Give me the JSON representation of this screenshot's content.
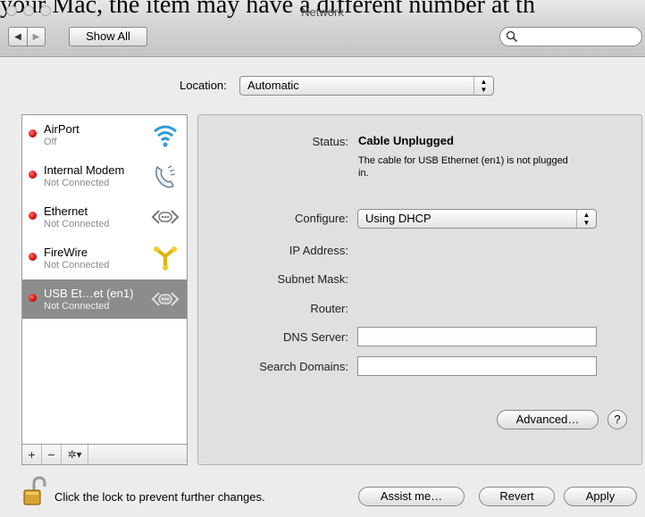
{
  "caption_fragment": "your Mac, the item may have a different number at th",
  "window": {
    "title": "Network"
  },
  "toolbar": {
    "back_glyph": "◀",
    "forward_glyph": "▶",
    "show_all_label": "Show All",
    "search_placeholder": ""
  },
  "location": {
    "label": "Location:",
    "value": "Automatic"
  },
  "services": [
    {
      "name": "AirPort",
      "status": "Off",
      "icon": "wifi-icon"
    },
    {
      "name": "Internal Modem",
      "status": "Not Connected",
      "icon": "phone-icon"
    },
    {
      "name": "Ethernet",
      "status": "Not Connected",
      "icon": "ethernet-icon"
    },
    {
      "name": "FireWire",
      "status": "Not Connected",
      "icon": "firewire-icon"
    },
    {
      "name": "USB Et…et (en1)",
      "status": "Not Connected",
      "icon": "ethernet-icon",
      "selected": true
    }
  ],
  "sidebar_controls": {
    "add": "+",
    "remove": "−",
    "gear": "✲▾"
  },
  "detail": {
    "status_label": "Status:",
    "status_value": "Cable Unplugged",
    "status_description": "The cable for USB Ethernet (en1) is not plugged in.",
    "configure_label": "Configure:",
    "configure_value": "Using DHCP",
    "ip_label": "IP Address:",
    "subnet_label": "Subnet Mask:",
    "router_label": "Router:",
    "dns_label": "DNS Server:",
    "dns_value": "",
    "search_domains_label": "Search Domains:",
    "search_domains_value": "",
    "advanced_label": "Advanced…",
    "help_label": "?"
  },
  "footer": {
    "lock_text": "Click the lock to prevent further changes.",
    "assist_label": "Assist me…",
    "revert_label": "Revert",
    "apply_label": "Apply"
  },
  "colors": {
    "status_dot": "#cc0000",
    "selection": "#8c8c8c"
  }
}
